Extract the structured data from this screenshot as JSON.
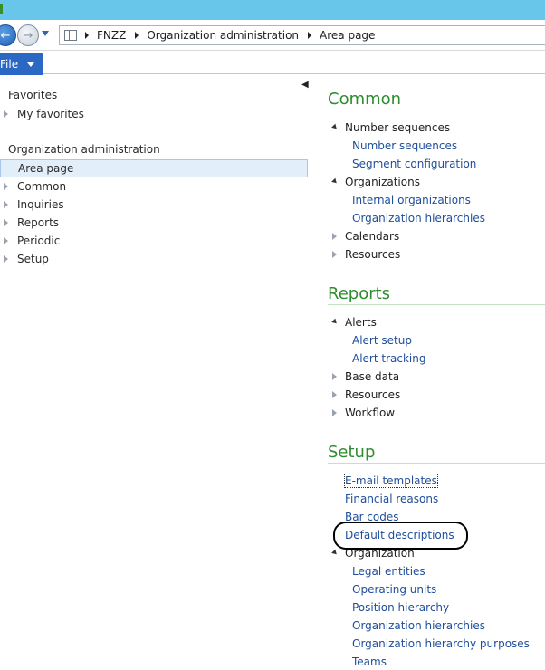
{
  "nav": {
    "breadcrumbs": [
      "FNZZ",
      "Organization administration",
      "Area page"
    ]
  },
  "ribbon": {
    "file_label": "File"
  },
  "left_pane": {
    "favorites_heading": "Favorites",
    "favorites_items": [
      {
        "label": "My favorites"
      }
    ],
    "module_heading": "Organization administration",
    "module_items": [
      {
        "label": "Area page",
        "selected": true
      },
      {
        "label": "Common"
      },
      {
        "label": "Inquiries"
      },
      {
        "label": "Reports"
      },
      {
        "label": "Periodic"
      },
      {
        "label": "Setup"
      }
    ]
  },
  "right_pane": {
    "sections": [
      {
        "title": "Common",
        "rows": [
          {
            "type": "group",
            "label": "Number sequences",
            "expanded": true
          },
          {
            "type": "link",
            "label": "Number sequences"
          },
          {
            "type": "link",
            "label": "Segment configuration"
          },
          {
            "type": "group",
            "label": "Organizations",
            "expanded": true
          },
          {
            "type": "link",
            "label": "Internal organizations"
          },
          {
            "type": "link",
            "label": "Organization hierarchies"
          },
          {
            "type": "group",
            "label": "Calendars",
            "expanded": false
          },
          {
            "type": "group",
            "label": "Resources",
            "expanded": false
          }
        ]
      },
      {
        "title": "Reports",
        "rows": [
          {
            "type": "group",
            "label": "Alerts",
            "expanded": true
          },
          {
            "type": "link",
            "label": "Alert setup"
          },
          {
            "type": "link",
            "label": "Alert tracking"
          },
          {
            "type": "group",
            "label": "Base data",
            "expanded": false
          },
          {
            "type": "group",
            "label": "Resources",
            "expanded": false
          },
          {
            "type": "group",
            "label": "Workflow",
            "expanded": false
          }
        ]
      },
      {
        "title": "Setup",
        "rows": [
          {
            "type": "toplink",
            "label": "E-mail templates",
            "focused": true
          },
          {
            "type": "toplink",
            "label": "Financial reasons"
          },
          {
            "type": "toplink",
            "label": "Bar codes"
          },
          {
            "type": "toplink",
            "label": "Default descriptions"
          },
          {
            "type": "group",
            "label": "Organization",
            "expanded": true
          },
          {
            "type": "link",
            "label": "Legal entities"
          },
          {
            "type": "link",
            "label": "Operating units"
          },
          {
            "type": "link",
            "label": "Position hierarchy"
          },
          {
            "type": "link",
            "label": "Organization hierarchies"
          },
          {
            "type": "link",
            "label": "Organization hierarchy purposes"
          },
          {
            "type": "link",
            "label": "Teams"
          }
        ]
      }
    ]
  },
  "colors": {
    "titlebar": "#67c6e9",
    "file_tab": "#2b68c4",
    "section_title": "#2e8b2e",
    "link": "#1f4e9a",
    "selected_bg": "#e3eefb"
  },
  "icons": [
    "back-arrow-icon",
    "forward-arrow-icon",
    "history-dropdown-icon",
    "page-grid-icon",
    "collapse-pane-icon"
  ]
}
